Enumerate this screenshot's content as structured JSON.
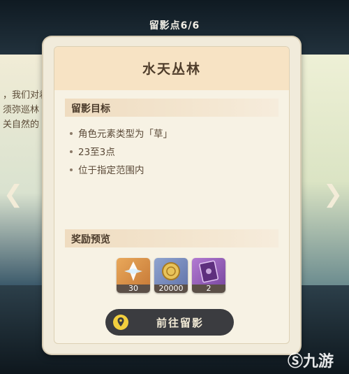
{
  "header": {
    "count_label": "留影点6/6"
  },
  "background": {
    "left_text_lines": [
      "，我们对着",
      "须弥巡林",
      "关自然的"
    ]
  },
  "card": {
    "title": "水天丛林",
    "goals_title": "留影目标",
    "goals": [
      "角色元素类型为「草」",
      "23至3点",
      "位于指定范围内"
    ],
    "rewards_title": "奖励预览",
    "rewards": [
      {
        "icon": "primogem-icon",
        "count": "30"
      },
      {
        "icon": "mora-icon",
        "count": "20000"
      },
      {
        "icon": "hero-wit-book-icon",
        "count": "2"
      }
    ],
    "go_button": "前往留影"
  },
  "watermark": "九游",
  "colors": {
    "accent_yellow": "#f2cf3e",
    "card_bg": "#f7f2e4",
    "title_band": "#f7e3c4"
  }
}
